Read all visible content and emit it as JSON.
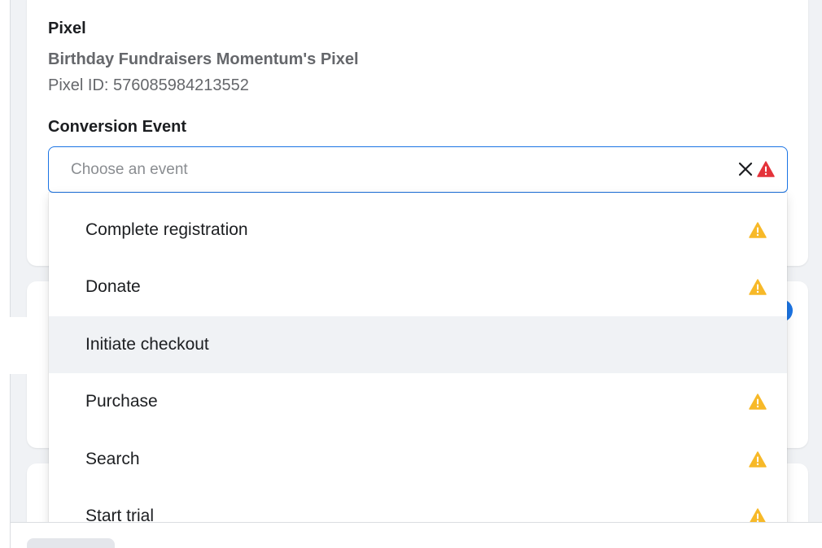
{
  "pixel_section": {
    "label": "Pixel",
    "pixel_name": "Birthday Fundraisers Momentum's Pixel",
    "pixel_id": "Pixel ID: 576085984213552"
  },
  "conversion": {
    "label": "Conversion Event",
    "placeholder": "Choose an event",
    "clear_icon": "close-icon",
    "error_icon": "alert-triangle-icon"
  },
  "dropdown": {
    "options": [
      {
        "label": "Complete registration",
        "warning": true
      },
      {
        "label": "Donate",
        "warning": true
      },
      {
        "label": "Initiate checkout",
        "warning": false,
        "highlighted": true
      },
      {
        "label": "Purchase",
        "warning": true
      },
      {
        "label": "Search",
        "warning": true
      },
      {
        "label": "Start trial",
        "warning": true
      }
    ]
  },
  "colors": {
    "accent": "#1b74e4",
    "error": "#e4333a",
    "warning": "#f7b928",
    "hover_bg": "#f0f2f5"
  }
}
